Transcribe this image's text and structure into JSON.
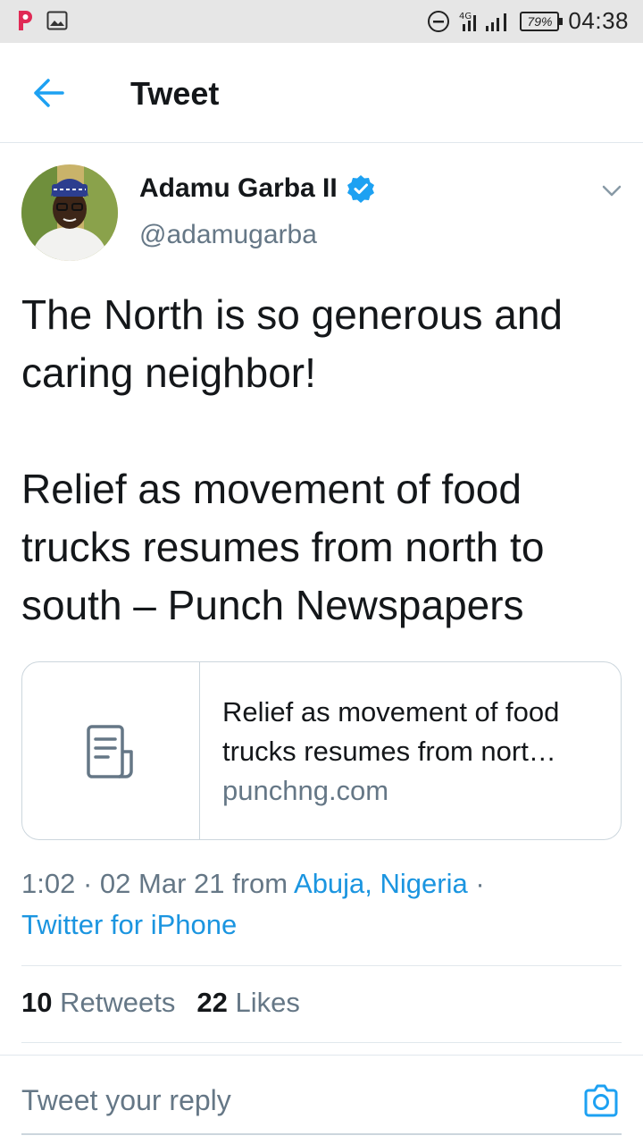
{
  "status_bar": {
    "network": "4G",
    "battery": "79%",
    "time": "04:38"
  },
  "header": {
    "title": "Tweet"
  },
  "tweet": {
    "author_name": "Adamu Garba II",
    "author_handle": "@adamugarba",
    "text": "The North is so generous and caring neighbor!\n\nRelief as movement of food trucks resumes from north to south – Punch Newspapers",
    "card": {
      "title": "Relief as movement of food trucks resumes from nort…",
      "domain": "punchng.com"
    },
    "meta": {
      "time": "1:02",
      "date": "02 Mar 21",
      "from_word": "from",
      "location": "Abuja, Nigeria",
      "source": "Twitter for iPhone"
    },
    "stats": {
      "retweets_count": "10",
      "retweets_label": "Retweets",
      "likes_count": "22",
      "likes_label": "Likes"
    }
  },
  "reply": {
    "placeholder": "Tweet your reply"
  },
  "colors": {
    "accent": "#1da1f2",
    "link": "#1b95e0",
    "secondary_text": "#657786",
    "status_bar_bg": "#e6e6e6"
  },
  "icons": [
    "app-p-icon",
    "gallery-icon",
    "dnd-icon",
    "signal-icon",
    "back-arrow-icon",
    "verified-badge-icon",
    "chevron-down-icon",
    "document-icon",
    "camera-icon"
  ]
}
